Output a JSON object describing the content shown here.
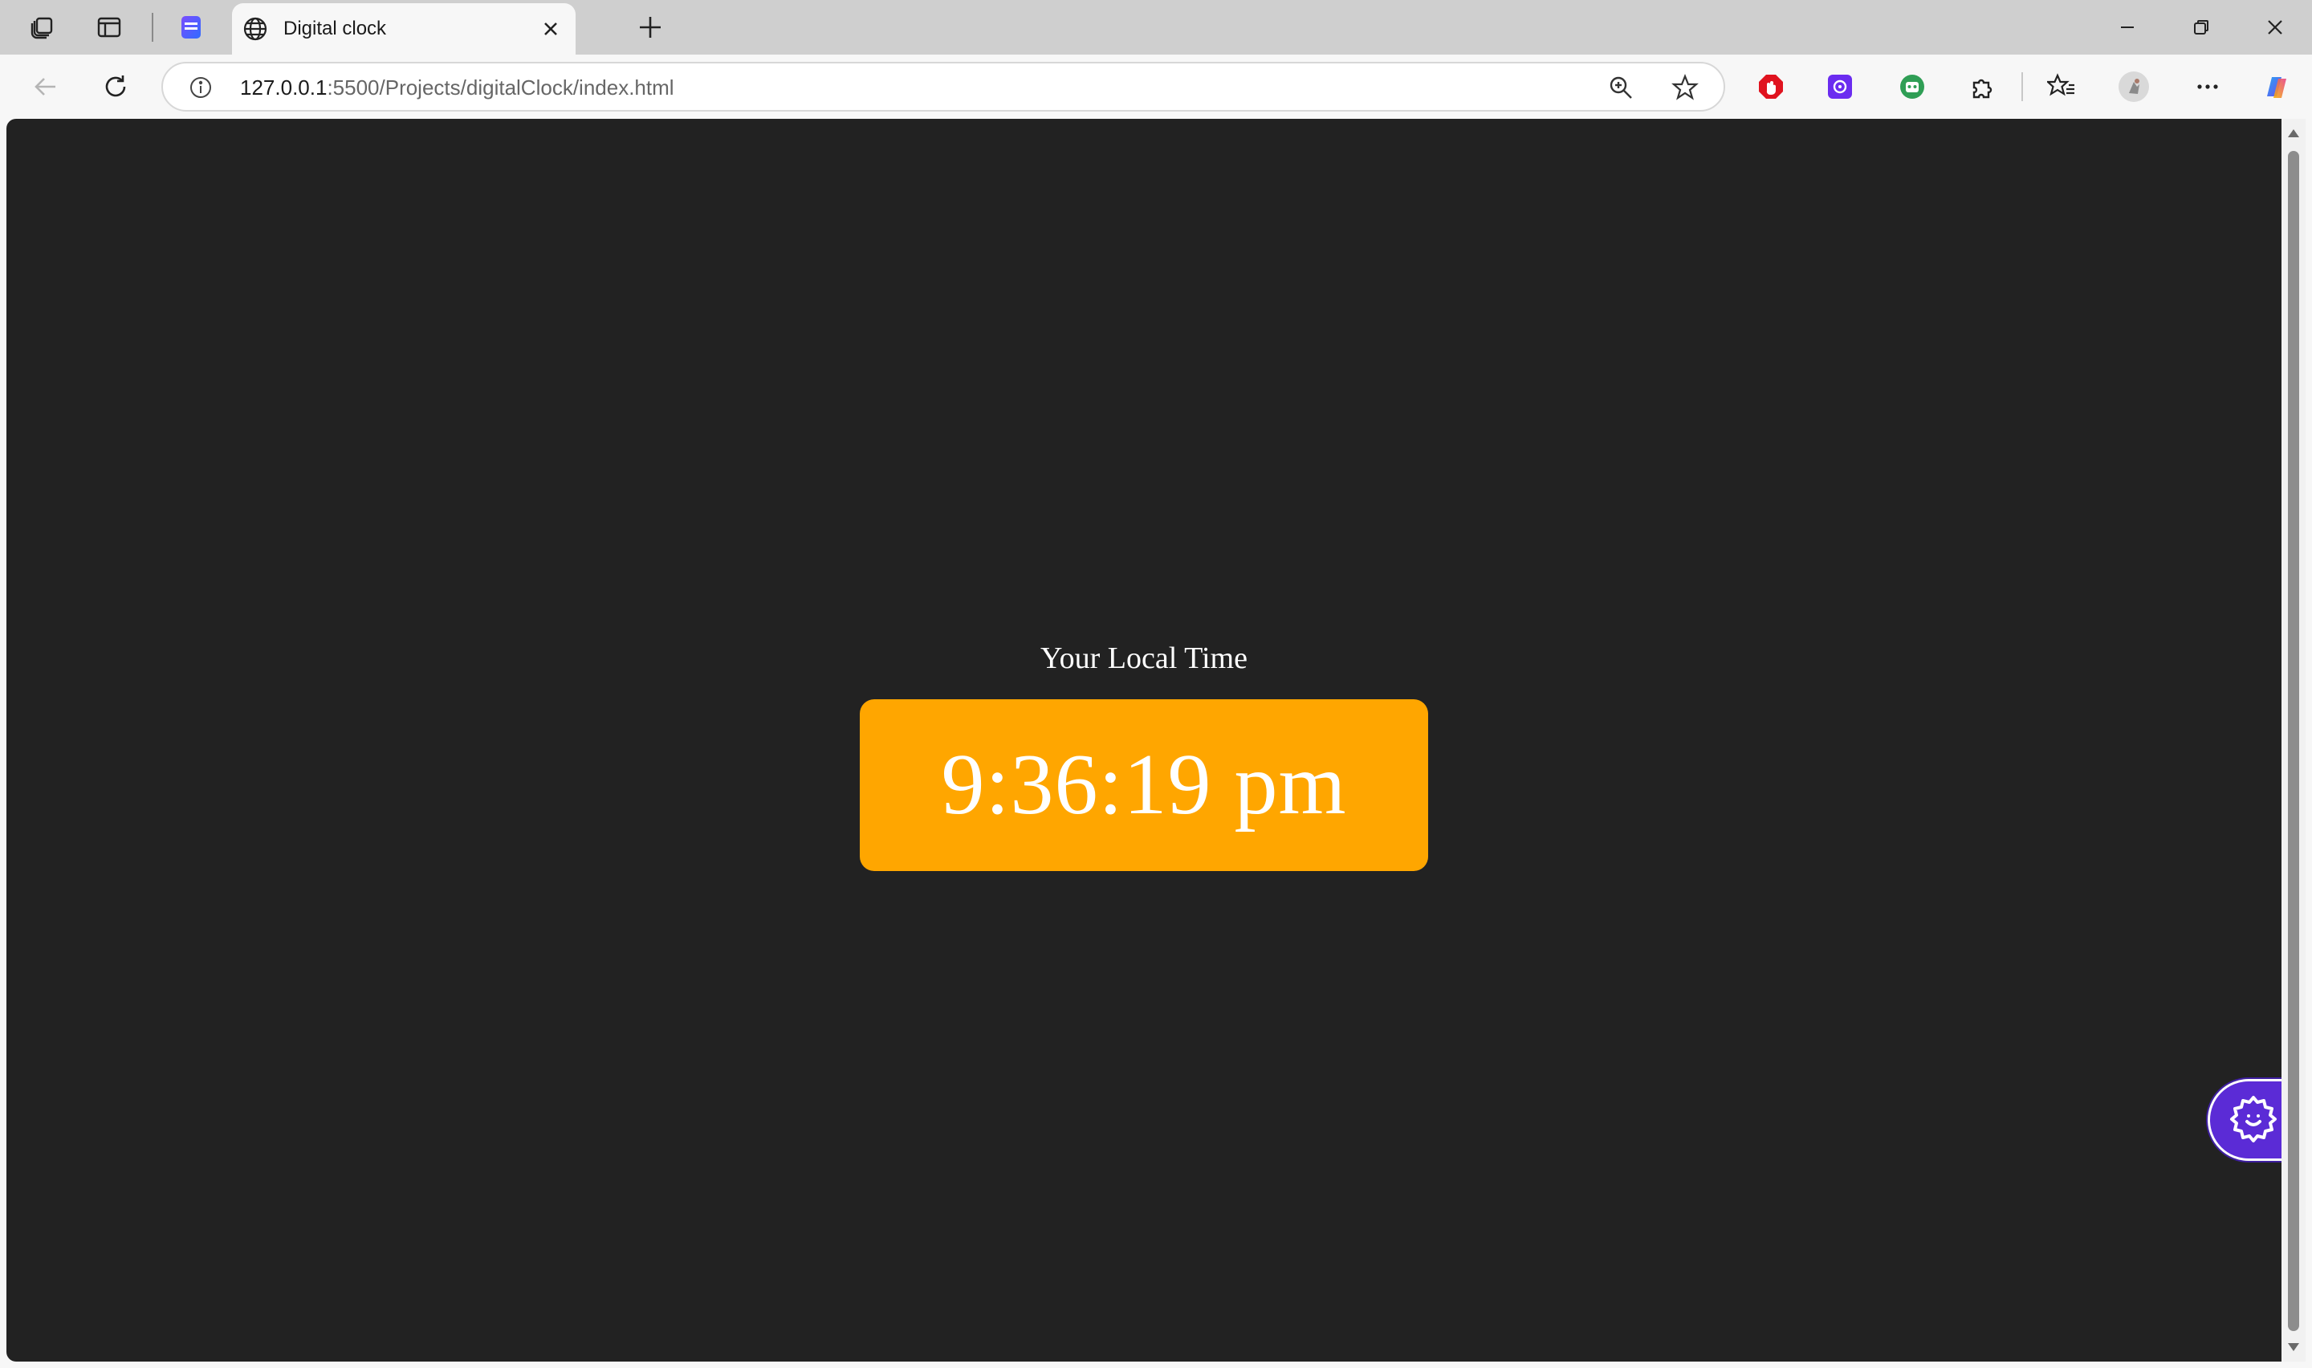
{
  "browser": {
    "tab": {
      "title": "Digital clock",
      "icon": "globe-icon"
    },
    "address_bar": {
      "url_host": "127.0.0.1",
      "url_rest": ":5500/Projects/digitalClock/index.html"
    },
    "extensions": [
      "adblock-icon",
      "purple-extension-icon",
      "green-robot-extension-icon",
      "puzzle-extensions-icon"
    ],
    "colors": {
      "tab_strip": "#cfcfcf",
      "toolbar": "#f7f7f7"
    }
  },
  "page": {
    "label": "Your Local Time",
    "time": "9:36:19 pm",
    "colors": {
      "background": "#222222",
      "clock_box": "#ffa600",
      "text": "#ffffff",
      "fab": "#5b2bd6"
    },
    "fab_icon": "gear-smile-icon"
  }
}
